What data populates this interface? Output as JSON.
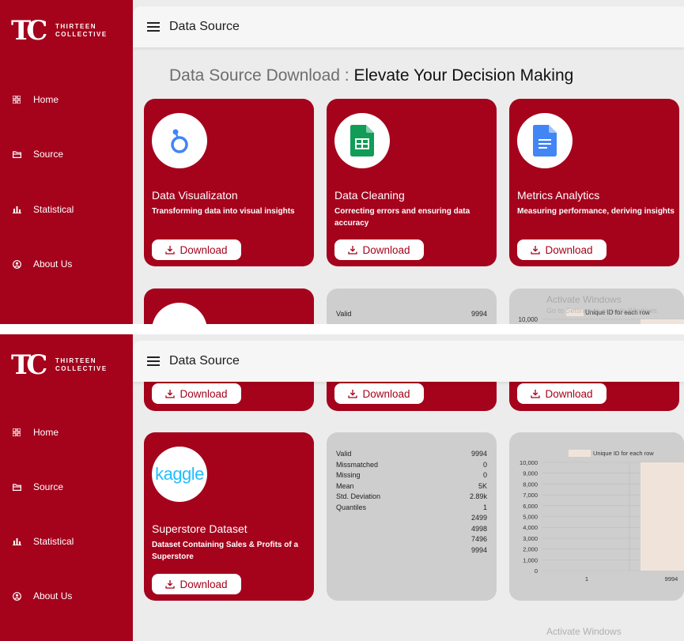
{
  "brand": {
    "line1": "THIRTEEN",
    "line2": "COLLECTIVE"
  },
  "nav": [
    {
      "label": "Home",
      "icon": "grid-icon"
    },
    {
      "label": "Source",
      "icon": "folder-icon"
    },
    {
      "label": "Statistical",
      "icon": "bar-chart-icon"
    },
    {
      "label": "About Us",
      "icon": "user-circle-icon"
    }
  ],
  "topbar": {
    "title": "Data Source"
  },
  "page": {
    "heading_prefix": "Data Source Download : ",
    "heading_main": "Elevate Your Decision Making"
  },
  "cards": [
    {
      "title": "Data Visualizaton",
      "desc": "Transforming data into visual insights",
      "button": "Download",
      "logo": "looker-studio-icon"
    },
    {
      "title": "Data Cleaning",
      "desc": "Correcting errors and ensuring data accuracy",
      "button": "Download",
      "logo": "google-sheets-icon"
    },
    {
      "title": "Metrics Analytics",
      "desc": "Measuring performance, deriving insights",
      "button": "Download",
      "logo": "google-docs-icon"
    },
    {
      "title": "Superstore Dataset",
      "desc": "Dataset Containing Sales & Profits of a Superstore",
      "button": "Download",
      "logo": "kaggle-logo",
      "logo_text": "kaggle"
    }
  ],
  "stats": {
    "rows": [
      {
        "label": "Valid",
        "value": "9994"
      },
      {
        "label": "Missmatched",
        "value": "0"
      },
      {
        "label": "Missing",
        "value": "0"
      },
      {
        "label": "Mean",
        "value": "5K"
      },
      {
        "label": "Std. Deviation",
        "value": "2.89k"
      },
      {
        "label": "Quantiles",
        "value": "1"
      },
      {
        "label": "",
        "value": "2499"
      },
      {
        "label": "",
        "value": "4998"
      },
      {
        "label": "",
        "value": "7496"
      },
      {
        "label": "",
        "value": "9994"
      }
    ]
  },
  "chart_data": {
    "type": "bar",
    "legend": "Unique ID for each row",
    "legend_position": "top",
    "yticks": [
      "10,000",
      "9,000",
      "8,000",
      "7,000",
      "6,000",
      "5,000",
      "4,000",
      "3,000",
      "2,000",
      "1,000",
      "0"
    ],
    "ylim": [
      0,
      10000
    ],
    "xticks": [
      "1",
      "9994"
    ],
    "x_range": [
      1,
      9994
    ],
    "series": [
      {
        "name": "Unique ID for each row",
        "color": "#f0e4da"
      }
    ],
    "grid": true
  },
  "watermark": {
    "title": "Activate Windows",
    "sub": "Go to Settings to activate Windows."
  },
  "colors": {
    "brand": "#a5021c",
    "panel": "#cecece",
    "bg": "#ececec",
    "bar": "#f0e4da"
  }
}
